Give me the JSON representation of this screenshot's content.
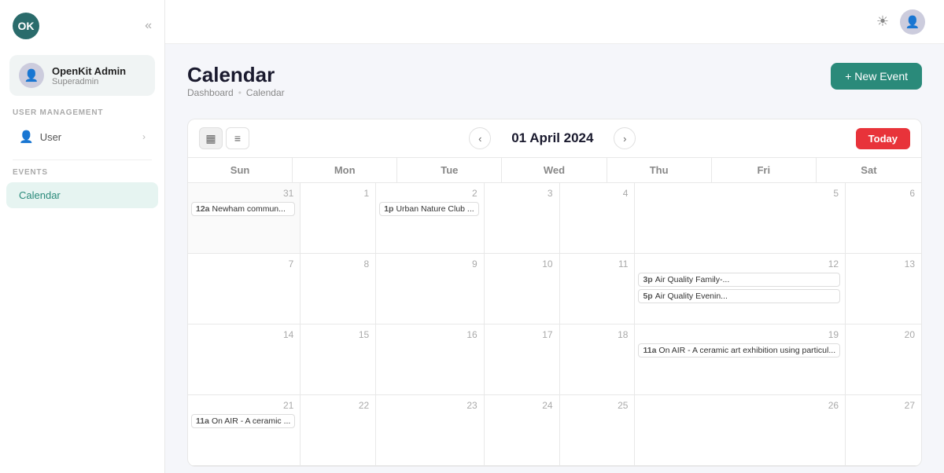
{
  "sidebar": {
    "logo_text": "OK",
    "app_name": "OpenKit",
    "collapse_icon": "«",
    "user": {
      "name": "OpenKit Admin",
      "role": "Superadmin"
    },
    "sections": [
      {
        "label": "USER MANAGEMENT",
        "items": [
          {
            "id": "user",
            "label": "User",
            "has_arrow": true
          }
        ]
      },
      {
        "label": "EVENTS",
        "items": [
          {
            "id": "calendar",
            "label": "Calendar",
            "active": true
          }
        ]
      }
    ]
  },
  "topbar": {
    "theme_icon": "☀",
    "avatar_icon": "👤"
  },
  "page": {
    "title": "Calendar",
    "breadcrumb": {
      "home": "Dashboard",
      "separator": "•",
      "current": "Calendar"
    },
    "new_event_label": "+ New Event"
  },
  "calendar": {
    "month_label": "01 April 2024",
    "today_label": "Today",
    "view_grid_icon": "▦",
    "view_list_icon": "≡",
    "nav_prev": "‹",
    "nav_next": "›",
    "day_headers": [
      "Sun",
      "Mon",
      "Tue",
      "Wed",
      "Thu",
      "Fri",
      "Sat"
    ],
    "weeks": [
      [
        {
          "date": "31",
          "outside": true,
          "events": [
            {
              "time": "12a",
              "title": "Newham commun..."
            }
          ]
        },
        {
          "date": "1",
          "outside": false,
          "events": []
        },
        {
          "date": "2",
          "outside": false,
          "events": [
            {
              "time": "1p",
              "title": "Urban Nature Club ..."
            }
          ]
        },
        {
          "date": "3",
          "outside": false,
          "events": []
        },
        {
          "date": "4",
          "outside": false,
          "events": []
        },
        {
          "date": "5",
          "outside": false,
          "events": []
        },
        {
          "date": "6",
          "outside": false,
          "events": []
        }
      ],
      [
        {
          "date": "7",
          "outside": false,
          "events": []
        },
        {
          "date": "8",
          "outside": false,
          "events": []
        },
        {
          "date": "9",
          "outside": false,
          "events": []
        },
        {
          "date": "10",
          "outside": false,
          "events": []
        },
        {
          "date": "11",
          "outside": false,
          "events": []
        },
        {
          "date": "12",
          "outside": false,
          "events": [
            {
              "time": "3p",
              "title": "Air Quality Family-..."
            },
            {
              "time": "5p",
              "title": "Air Quality Evenin..."
            }
          ]
        },
        {
          "date": "13",
          "outside": false,
          "events": []
        }
      ],
      [
        {
          "date": "14",
          "outside": false,
          "events": []
        },
        {
          "date": "15",
          "outside": false,
          "events": []
        },
        {
          "date": "16",
          "outside": false,
          "events": []
        },
        {
          "date": "17",
          "outside": false,
          "events": []
        },
        {
          "date": "18",
          "outside": false,
          "events": []
        },
        {
          "date": "19",
          "outside": false,
          "events": [
            {
              "time": "11a",
              "title": "On AIR - A ceramic art exhibition using particul..."
            }
          ]
        },
        {
          "date": "20",
          "outside": false,
          "events": []
        }
      ],
      [
        {
          "date": "21",
          "outside": false,
          "events": [
            {
              "time": "11a",
              "title": "On AIR - A ceramic ..."
            }
          ]
        },
        {
          "date": "22",
          "outside": false,
          "events": []
        },
        {
          "date": "23",
          "outside": false,
          "events": []
        },
        {
          "date": "24",
          "outside": false,
          "events": []
        },
        {
          "date": "25",
          "outside": false,
          "events": []
        },
        {
          "date": "26",
          "outside": false,
          "events": []
        },
        {
          "date": "27",
          "outside": false,
          "events": []
        }
      ]
    ]
  }
}
